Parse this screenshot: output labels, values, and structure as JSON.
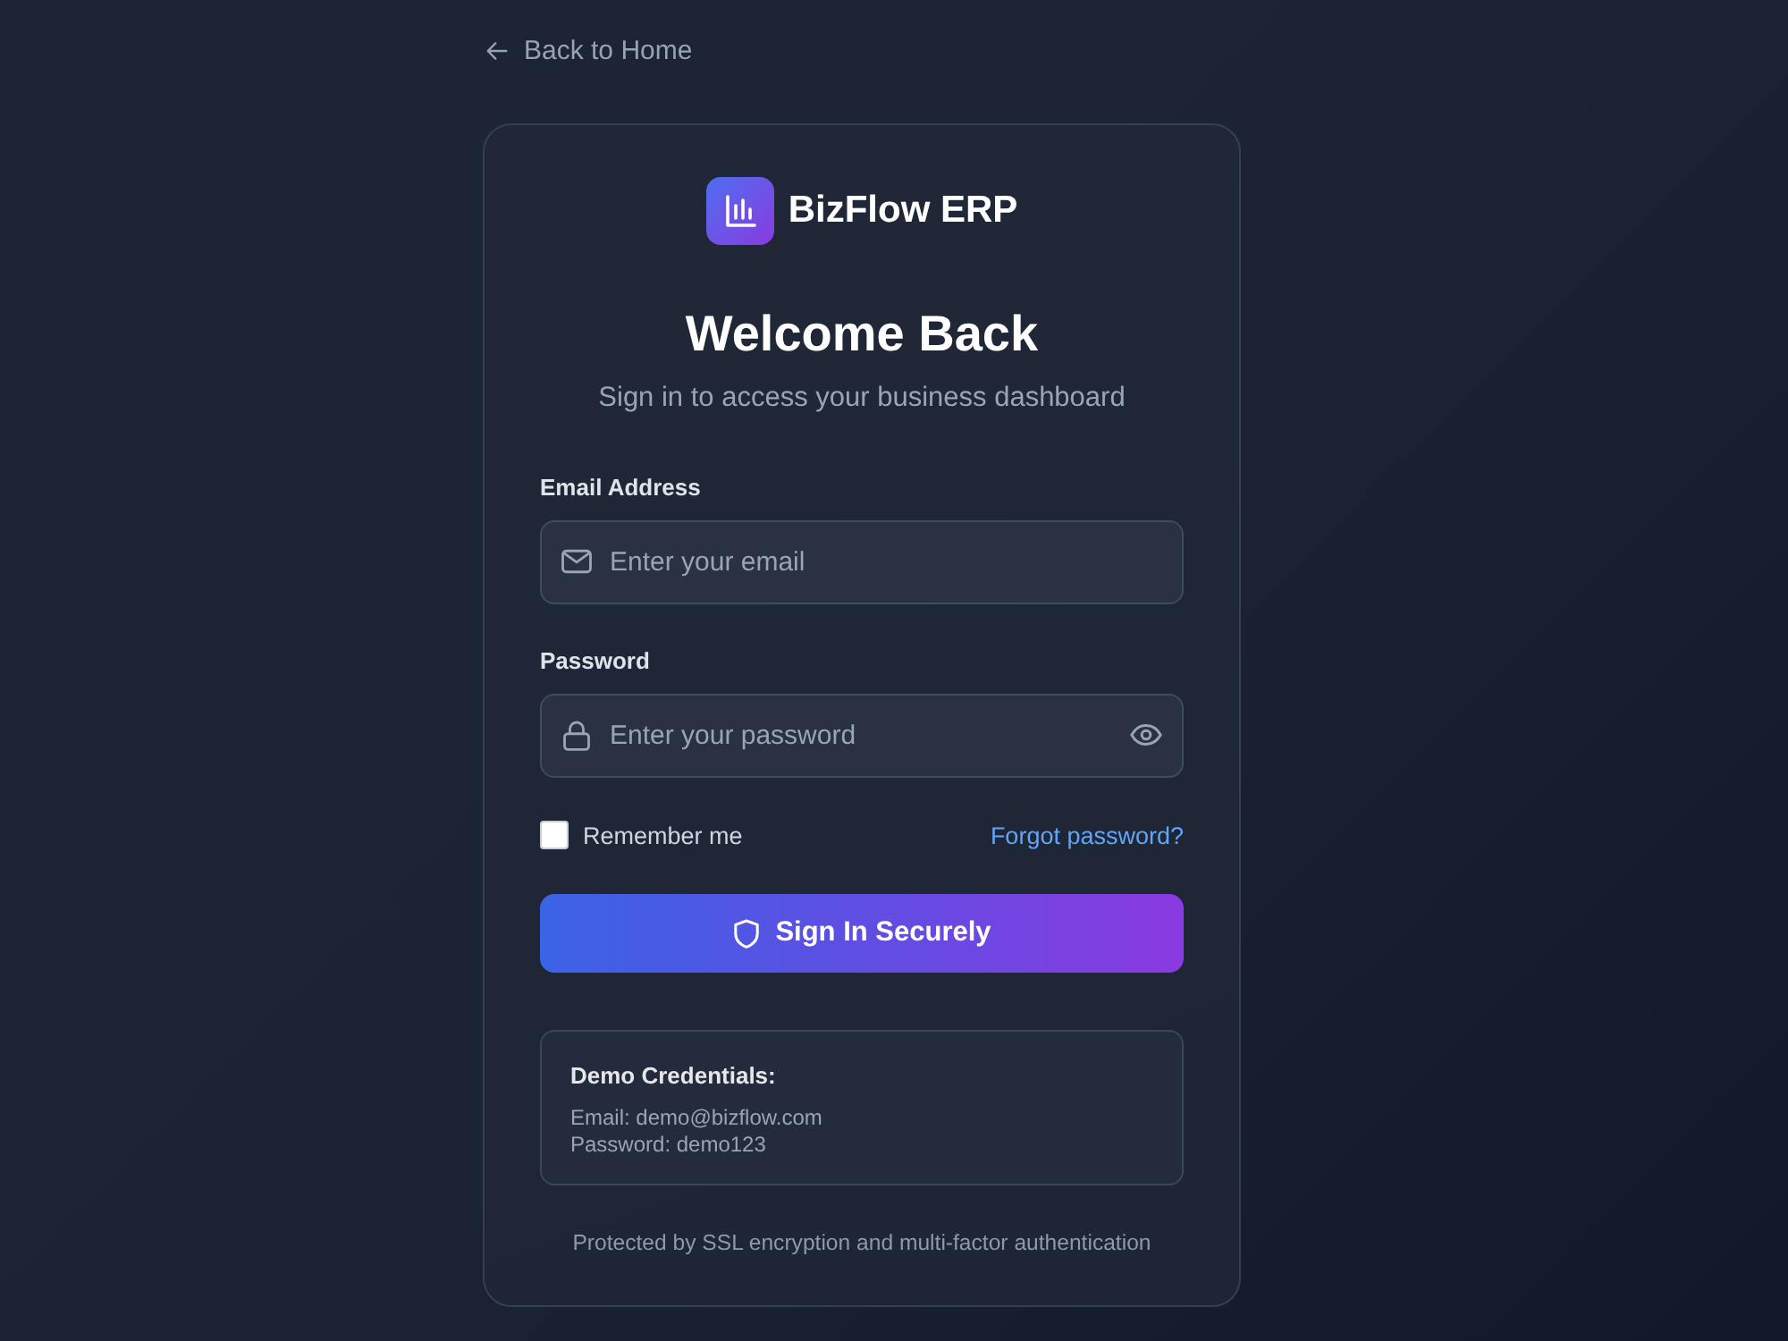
{
  "back_link": {
    "label": "Back to Home"
  },
  "brand": {
    "name": "BizFlow ERP"
  },
  "heading": {
    "title": "Welcome Back",
    "subtitle": "Sign in to access your business dashboard"
  },
  "fields": [
    {
      "kind": "email",
      "label": "Email Address",
      "placeholder": "Enter your email"
    },
    {
      "kind": "password",
      "label": "Password",
      "placeholder": "Enter your password"
    }
  ],
  "remember": {
    "label": "Remember me",
    "checked": false
  },
  "forgot_link": {
    "label": "Forgot password?"
  },
  "submit_button": {
    "label": "Sign In Securely"
  },
  "demo_credentials": {
    "title": "Demo Credentials:",
    "lines": [
      "Email: demo@bizflow.com",
      "Password: demo123"
    ]
  },
  "footer_note": "Protected by SSL encryption and multi-factor authentication"
}
